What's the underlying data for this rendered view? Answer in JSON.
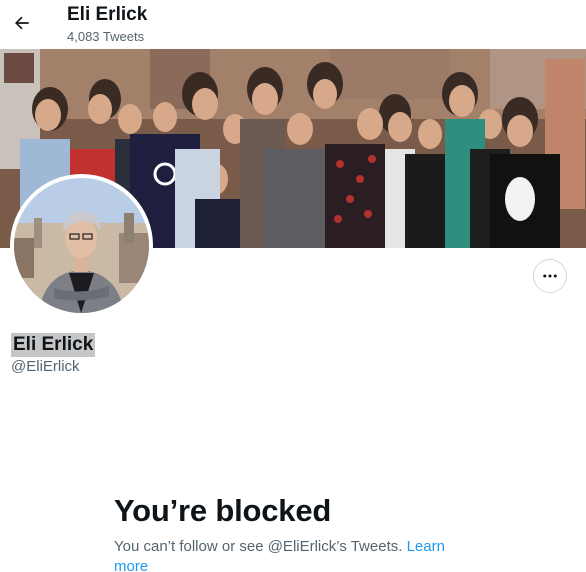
{
  "header": {
    "title": "Eli Erlick",
    "subtitle": "4,083 Tweets",
    "back_icon": "arrow-left-icon"
  },
  "profile": {
    "display_name": "Eli Erlick",
    "handle": "@EliErlick",
    "more_icon": "more-horizontal-icon"
  },
  "blocked": {
    "title": "You’re blocked",
    "message": "You can’t follow or see @EliErlick’s Tweets.",
    "link_label": "Learn more"
  },
  "colors": {
    "accent": "#1d9bf0",
    "text_primary": "#0f1419",
    "text_secondary": "#536471",
    "border": "#cfd9de",
    "name_highlight": "#c6c6c6"
  }
}
